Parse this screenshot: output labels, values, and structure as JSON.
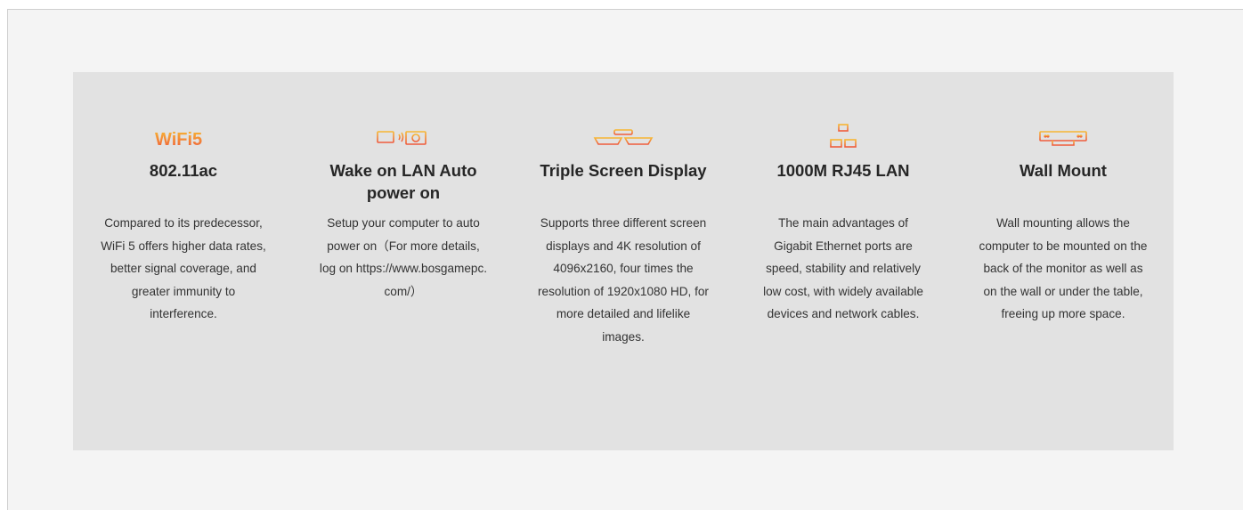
{
  "accent_color": "#f29a1f",
  "features": [
    {
      "icon": "wifi5-icon",
      "icon_text": "WiFi5",
      "title": "802.11ac",
      "description": "Compared to its predecessor, WiFi 5 offers higher data rates, better signal coverage, and greater immunity to interference."
    },
    {
      "icon": "wake-on-lan-icon",
      "title": "Wake on LAN  Auto power on",
      "description": "Setup your computer to auto power on（For more details, log on https://www.bosgamepc. com/）"
    },
    {
      "icon": "triple-screen-icon",
      "title": "Triple Screen Display",
      "description": "Supports three different screen displays and 4K resolution of 4096x2160, four times the resolution of 1920x1080 HD, for more detailed and lifelike images."
    },
    {
      "icon": "network-lan-icon",
      "title": "1000M RJ45 LAN",
      "description": "The main advantages of Gigabit Ethernet ports are speed, stability and relatively low cost, with widely available devices and network cables."
    },
    {
      "icon": "wall-mount-icon",
      "title": "Wall Mount",
      "description": "Wall mounting allows the computer to be mounted on the back of the monitor as well as on the wall or under the table, freeing up more space."
    }
  ]
}
